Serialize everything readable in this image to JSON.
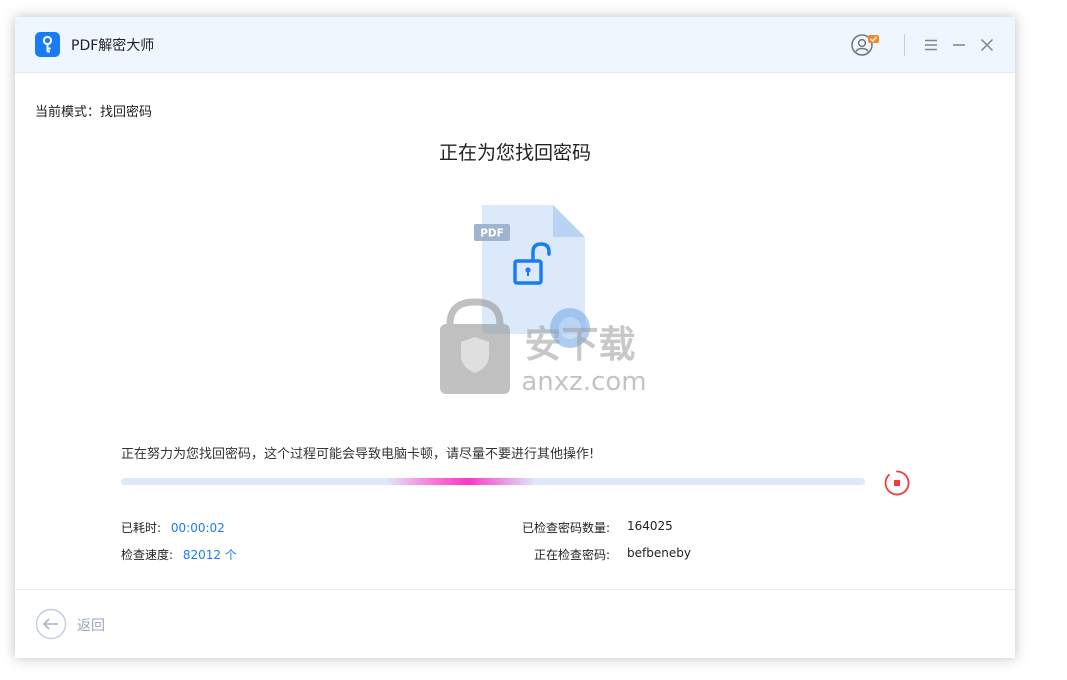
{
  "window": {
    "title": "PDF解密大师"
  },
  "mode": {
    "label": "当前模式：",
    "value": "找回密码"
  },
  "heading": "正在为您找回密码",
  "illustration": {
    "file_tag": "PDF"
  },
  "watermark": {
    "brand": "安下载",
    "domain": "anxz.com"
  },
  "progress": {
    "message": "正在努力为您找回密码，这个过程可能会导致电脑卡顿，请尽量不要进行其他操作!"
  },
  "stats": {
    "elapsed_label": "已耗时:",
    "elapsed_value": "00:00:02",
    "speed_label": "检查速度:",
    "speed_value": "82012 个",
    "checked_label": "已检查密码数量:",
    "checked_value": "164025",
    "current_label": "正在检查密码:",
    "current_value": "befbeneby"
  },
  "footer": {
    "back_label": "返回"
  },
  "colors": {
    "accent": "#1a7cf5",
    "stop": "#f23c3c",
    "progress_glow": "#f63cc9",
    "titlebar_bg": "#f0f6fe"
  },
  "icons": [
    "key-icon",
    "user-account-icon",
    "menu-icon",
    "minimize-icon",
    "close-icon",
    "unlock-icon",
    "stop-icon",
    "back-arrow-icon"
  ]
}
